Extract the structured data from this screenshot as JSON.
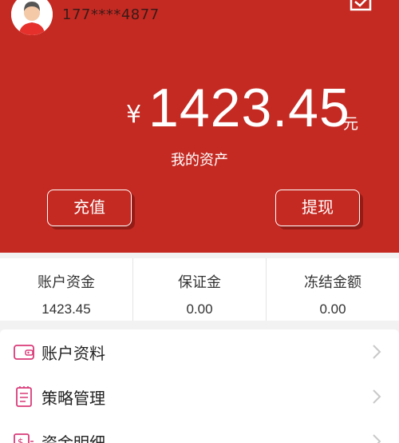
{
  "user": {
    "phone": "177****4877"
  },
  "balance": {
    "currency_symbol": "¥",
    "amount": "1423.45",
    "unit": "元",
    "label": "我的资产"
  },
  "actions": {
    "recharge": "充值",
    "withdraw": "提现"
  },
  "stats": [
    {
      "label": "账户资金",
      "value": "1423.45"
    },
    {
      "label": "保证金",
      "value": "0.00"
    },
    {
      "label": "冻结金额",
      "value": "0.00"
    }
  ],
  "menu": [
    {
      "label": "账户资料",
      "icon": "wallet-icon"
    },
    {
      "label": "策略管理",
      "icon": "document-icon"
    },
    {
      "label": "资金明细",
      "icon": "money-list-icon"
    }
  ],
  "colors": {
    "header_bg": "#c42a22",
    "accent_icon": "#d93a78"
  }
}
